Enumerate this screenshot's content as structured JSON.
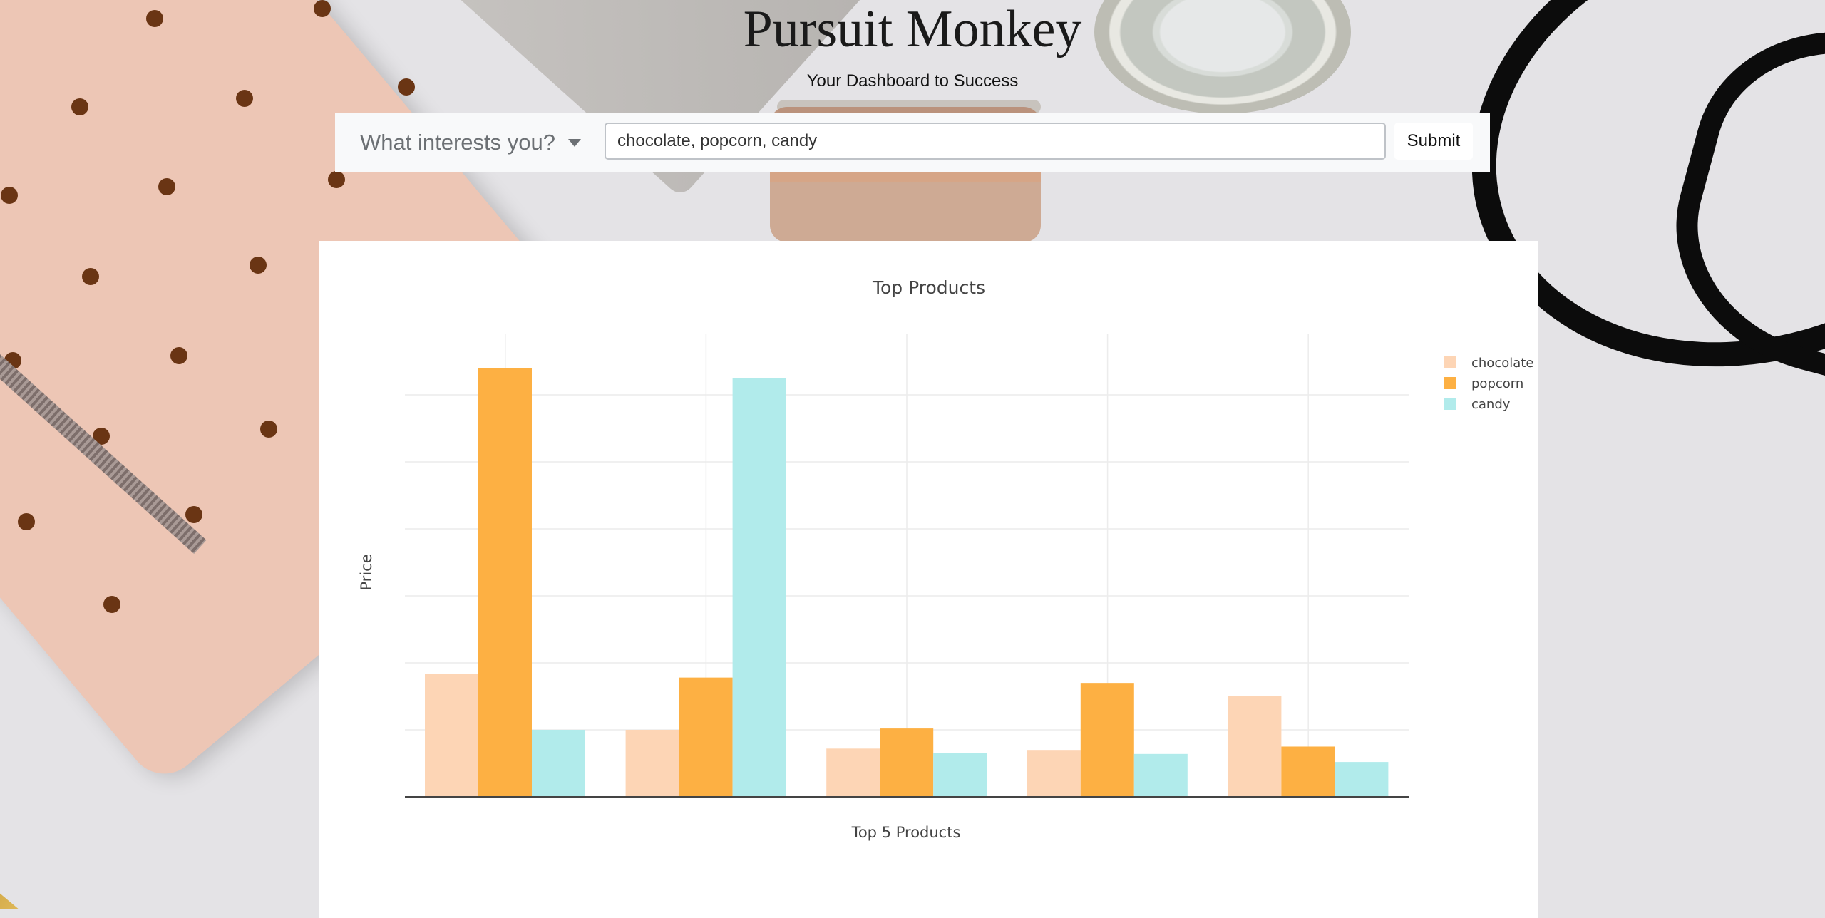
{
  "header": {
    "brand": "Pursuit Monkey",
    "tagline": "Your Dashboard to Success"
  },
  "search": {
    "dropdown_label": "What interests you?",
    "query_value": "chocolate, popcorn, candy",
    "submit_label": "Submit"
  },
  "colors": {
    "chocolate": "#fdd5b5",
    "popcorn": "#fdb043",
    "candy": "#b1ebeb"
  },
  "chart_data": {
    "type": "bar",
    "title": "Top Products",
    "xlabel": "Top 5 Products",
    "ylabel": "Price",
    "categories": [
      "",
      "",
      "",
      "",
      ""
    ],
    "series": [
      {
        "name": "chocolate",
        "values": [
          18.3,
          10.0,
          7.2,
          7.0,
          15.0
        ]
      },
      {
        "name": "popcorn",
        "values": [
          64.0,
          17.8,
          10.2,
          17.0,
          7.5
        ]
      },
      {
        "name": "candy",
        "values": [
          10.0,
          62.5,
          6.5,
          6.4,
          5.2
        ]
      }
    ],
    "ylim": [
      0,
      67
    ],
    "grid": true,
    "legend_position": "top-right"
  }
}
